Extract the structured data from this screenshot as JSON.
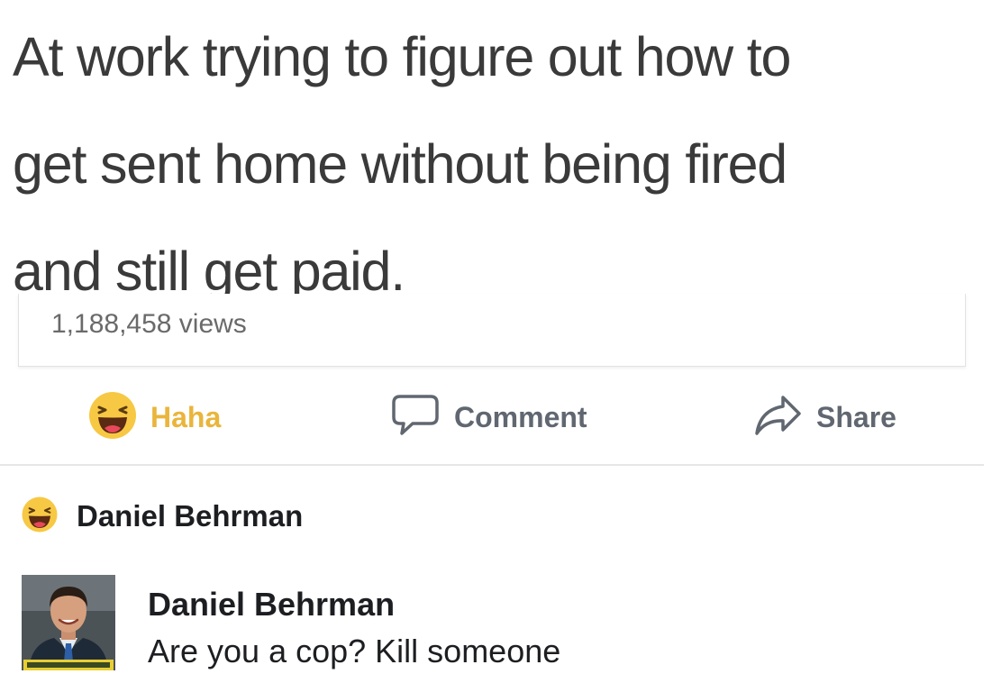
{
  "post": {
    "text_lines": [
      "At work trying to figure out how to",
      "get sent home without being fired",
      "and still get paid."
    ],
    "views": "1,188,458 views"
  },
  "actions": {
    "haha_label": "Haha",
    "comment_label": "Comment",
    "share_label": "Share"
  },
  "icons": {
    "haha": "laughing-face-icon",
    "comment": "speech-bubble-icon",
    "share": "share-arrow-icon"
  },
  "reaction": {
    "name": "Daniel Behrman"
  },
  "comment": {
    "author": "Daniel Behrman",
    "text": "Are you a cop? Kill someone"
  },
  "colors": {
    "haha_accent": "#e9b53b",
    "action_gray": "#606770",
    "post_text": "#3a3a3a"
  }
}
